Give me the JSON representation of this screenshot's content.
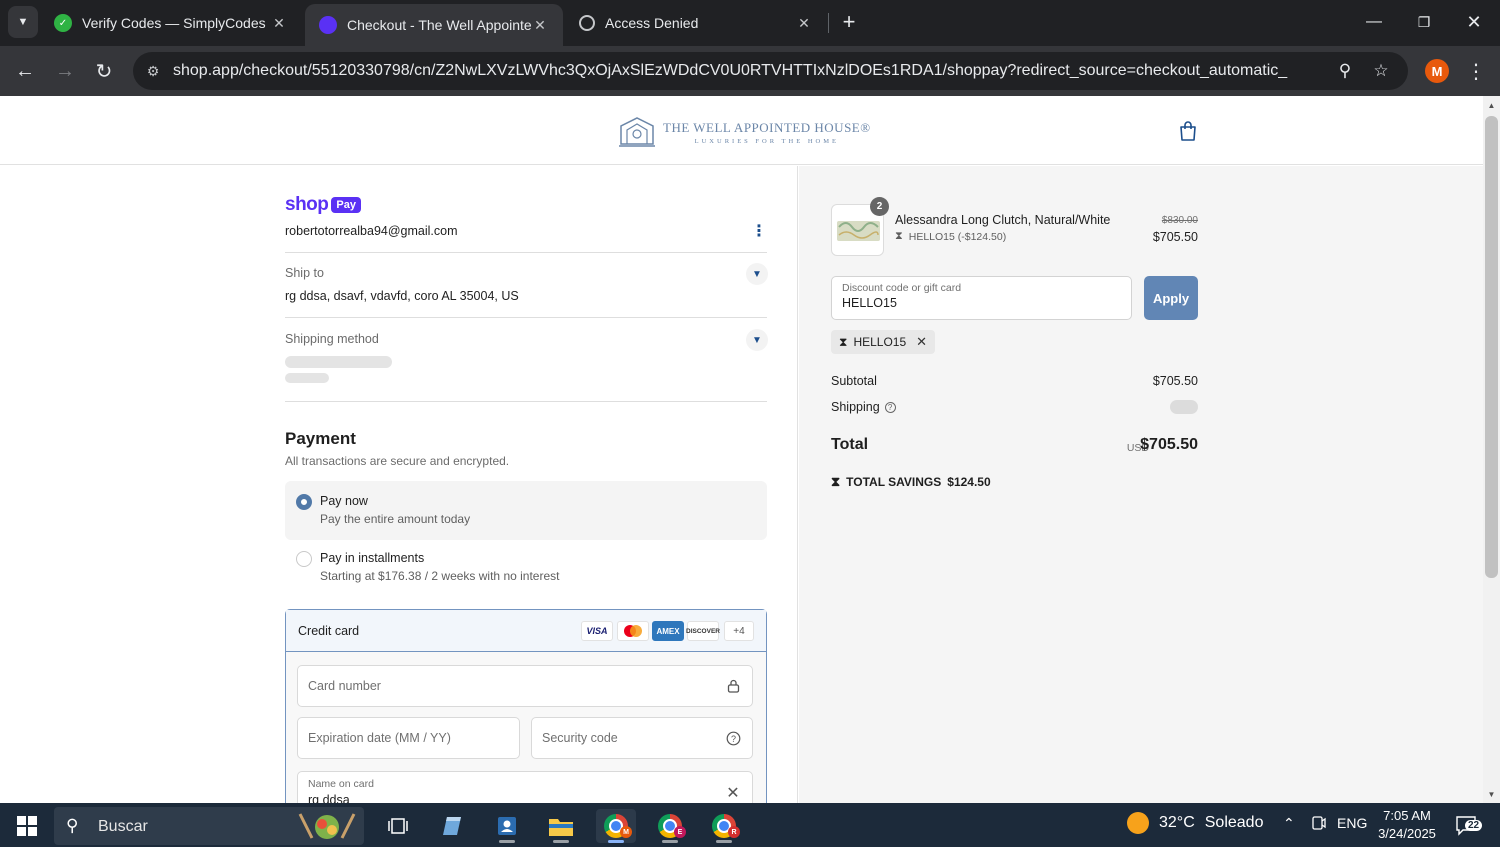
{
  "browser": {
    "tabs": [
      {
        "title": "Verify Codes — SimplyCodes",
        "active": false
      },
      {
        "title": "Checkout - The Well Appointed",
        "active": true
      },
      {
        "title": "Access Denied",
        "active": false
      }
    ],
    "url": "shop.app/checkout/55120330798/cn/Z2NwLXVzLWVhc3QxOjAxSlEzWDdCV0U0RTVHTTIxNzlDOEs1RDA1/shoppay?redirect_source=checkout_automatic_redirect&track...",
    "profile_initial": "M"
  },
  "header": {
    "logo_name": "THE WELL APPOINTED HOUSE®",
    "logo_tagline": "LUXURIES FOR THE HOME"
  },
  "account": {
    "shop_word": "shop",
    "pay_badge": "Pay",
    "email": "robertotorrealba94@gmail.com"
  },
  "ship_to": {
    "label": "Ship to",
    "address": "rg ddsa, dsavf, vdavfd, coro AL 35004, US"
  },
  "shipping_method": {
    "label": "Shipping method"
  },
  "payment": {
    "title": "Payment",
    "subtitle": "All transactions are secure and encrypted.",
    "options": [
      {
        "title": "Pay now",
        "subtitle": "Pay the entire amount today",
        "selected": true
      },
      {
        "title": "Pay in installments",
        "subtitle": "Starting at $176.38 / 2 weeks with no interest",
        "selected": false
      }
    ],
    "card": {
      "title": "Credit card",
      "brands": [
        "VISA",
        "mastercard",
        "AMEX",
        "DISCOVER",
        "+4"
      ],
      "card_number_placeholder": "Card number",
      "expiry_placeholder": "Expiration date (MM / YY)",
      "security_placeholder": "Security code",
      "name_label": "Name on card",
      "name_value": "rg ddsa"
    }
  },
  "summary": {
    "item": {
      "quantity": "2",
      "name": "Alessandra Long Clutch, Natural/White",
      "discount": "HELLO15 (-$124.50)",
      "original_price": "$830.00",
      "price": "$705.50"
    },
    "discount_field": {
      "label": "Discount code or gift card",
      "value": "HELLO15"
    },
    "apply_label": "Apply",
    "applied_code": "HELLO15",
    "subtotal_label": "Subtotal",
    "subtotal_value": "$705.50",
    "shipping_label": "Shipping",
    "total_label": "Total",
    "currency": "USD",
    "total_value": "$705.50",
    "savings_label": "TOTAL SAVINGS",
    "savings_value": "$124.50"
  },
  "taskbar": {
    "search_placeholder": "Buscar",
    "weather_temp": "32°C",
    "weather_text": "Soleado",
    "language": "ENG",
    "time": "7:05 AM",
    "date": "3/24/2025",
    "notification_count": "22"
  },
  "colors": {
    "shop_purple": "#5a31f4",
    "apply_button": "#6186b5",
    "selected_radio": "#5179a8",
    "brand_blue": "#6b86a8"
  }
}
